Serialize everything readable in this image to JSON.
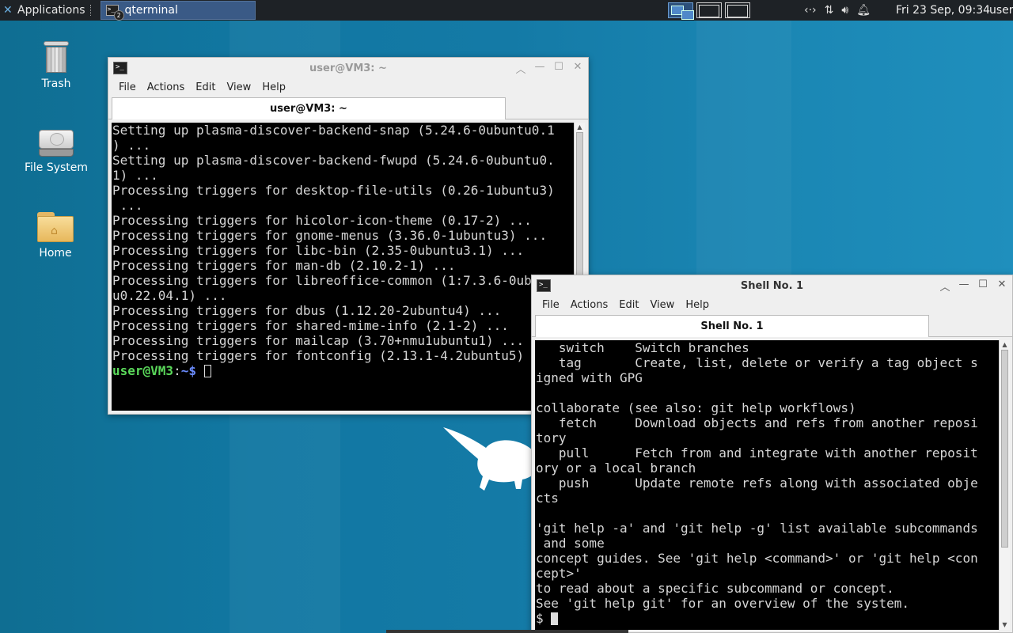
{
  "panel": {
    "apps_label": "Applications",
    "task_label": "qterminal",
    "task_count": "2",
    "clock": "Fri 23 Sep, 09:34",
    "user": "user"
  },
  "desktop": {
    "icons": [
      {
        "label": "Trash"
      },
      {
        "label": "File System"
      },
      {
        "label": "Home"
      }
    ]
  },
  "window_a": {
    "title": "user@VM3: ~",
    "menu": [
      "File",
      "Actions",
      "Edit",
      "View",
      "Help"
    ],
    "tab_label": "user@VM3: ~",
    "lines": [
      "Setting up plasma-discover-backend-snap (5.24.6-0ubuntu0.1",
      ") ...",
      "Setting up plasma-discover-backend-fwupd (5.24.6-0ubuntu0.",
      "1) ...",
      "Processing triggers for desktop-file-utils (0.26-1ubuntu3)",
      " ...",
      "Processing triggers for hicolor-icon-theme (0.17-2) ...",
      "Processing triggers for gnome-menus (3.36.0-1ubuntu3) ...",
      "Processing triggers for libc-bin (2.35-0ubuntu3.1) ...",
      "Processing triggers for man-db (2.10.2-1) ...",
      "Processing triggers for libreoffice-common (1:7.3.6-0ubuntu",
      "u0.22.04.1) ...",
      "Processing triggers for dbus (1.12.20-2ubuntu4) ...",
      "Processing triggers for shared-mime-info (2.1-2) ...",
      "Processing triggers for mailcap (3.70+nmu1ubuntu1) ...",
      "Processing triggers for fontconfig (2.13.1-4.2ubuntu5) ..."
    ],
    "prompt_user": "user@VM3",
    "prompt_sep": ":",
    "prompt_path": "~$ "
  },
  "window_b": {
    "title": "Shell No. 1",
    "menu": [
      "File",
      "Actions",
      "Edit",
      "View",
      "Help"
    ],
    "tab_label": "Shell No. 1",
    "lines": [
      "   switch    Switch branches",
      "   tag       Create, list, delete or verify a tag object s",
      "igned with GPG",
      "",
      "collaborate (see also: git help workflows)",
      "   fetch     Download objects and refs from another reposi",
      "tory",
      "   pull      Fetch from and integrate with another reposit",
      "ory or a local branch",
      "   push      Update remote refs along with associated obje",
      "cts",
      "",
      "'git help -a' and 'git help -g' list available subcommands",
      " and some",
      "concept guides. See 'git help <command>' or 'git help <con",
      "cept>'",
      "to read about a specific subcommand or concept.",
      "See 'git help git' for an overview of the system."
    ],
    "prompt": "$ "
  }
}
